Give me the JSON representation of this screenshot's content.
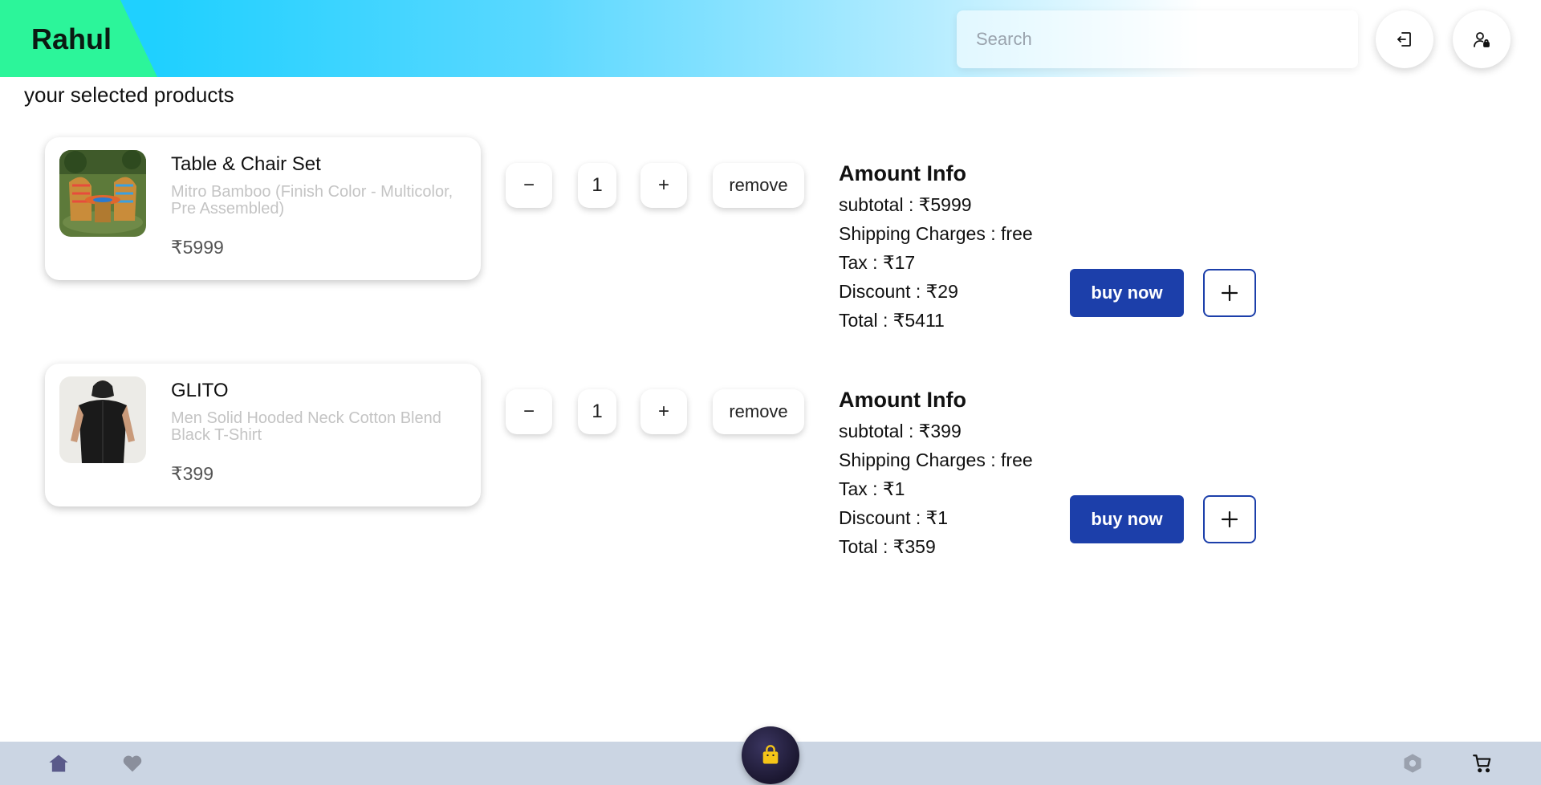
{
  "header": {
    "brand": "Rahul",
    "search_placeholder": "Search"
  },
  "section_title": "your selected products",
  "products": [
    {
      "name": "Table & Chair Set",
      "description": "Mitro Bamboo (Finish Color - Multicolor, Pre Assembled)",
      "price": "₹5999",
      "quantity": "1",
      "amount": {
        "title": "Amount Info",
        "subtotal": "subtotal : ₹5999",
        "shipping": "Shipping Charges : free",
        "tax": "Tax : ₹17",
        "discount": "Discount : ₹29",
        "total": "Total : ₹5411"
      }
    },
    {
      "name": "GLITO",
      "description": "Men Solid Hooded Neck Cotton Blend Black T-Shirt",
      "price": "₹399",
      "quantity": "1",
      "amount": {
        "title": "Amount Info",
        "subtotal": "subtotal : ₹399",
        "shipping": "Shipping Charges : free",
        "tax": "Tax : ₹1",
        "discount": "Discount : ₹1",
        "total": "Total : ₹359"
      }
    }
  ],
  "controls": {
    "minus": "−",
    "plus": "+",
    "remove": "remove",
    "buy_now": "buy now"
  },
  "icons": {
    "logout": "logout-icon",
    "user": "user-lock-icon",
    "home": "home-icon",
    "heart": "heart-icon",
    "bag": "shopping-bag-icon",
    "settings": "hexagon-icon",
    "cart": "cart-icon"
  },
  "colors": {
    "brand_green": "#2cf59a",
    "header_cyan": "#1fd0ff",
    "primary_blue": "#1c3faa",
    "bottom_bar": "#cbd5e3",
    "fab": "#1b1730",
    "bag_yellow": "#f5c518"
  }
}
